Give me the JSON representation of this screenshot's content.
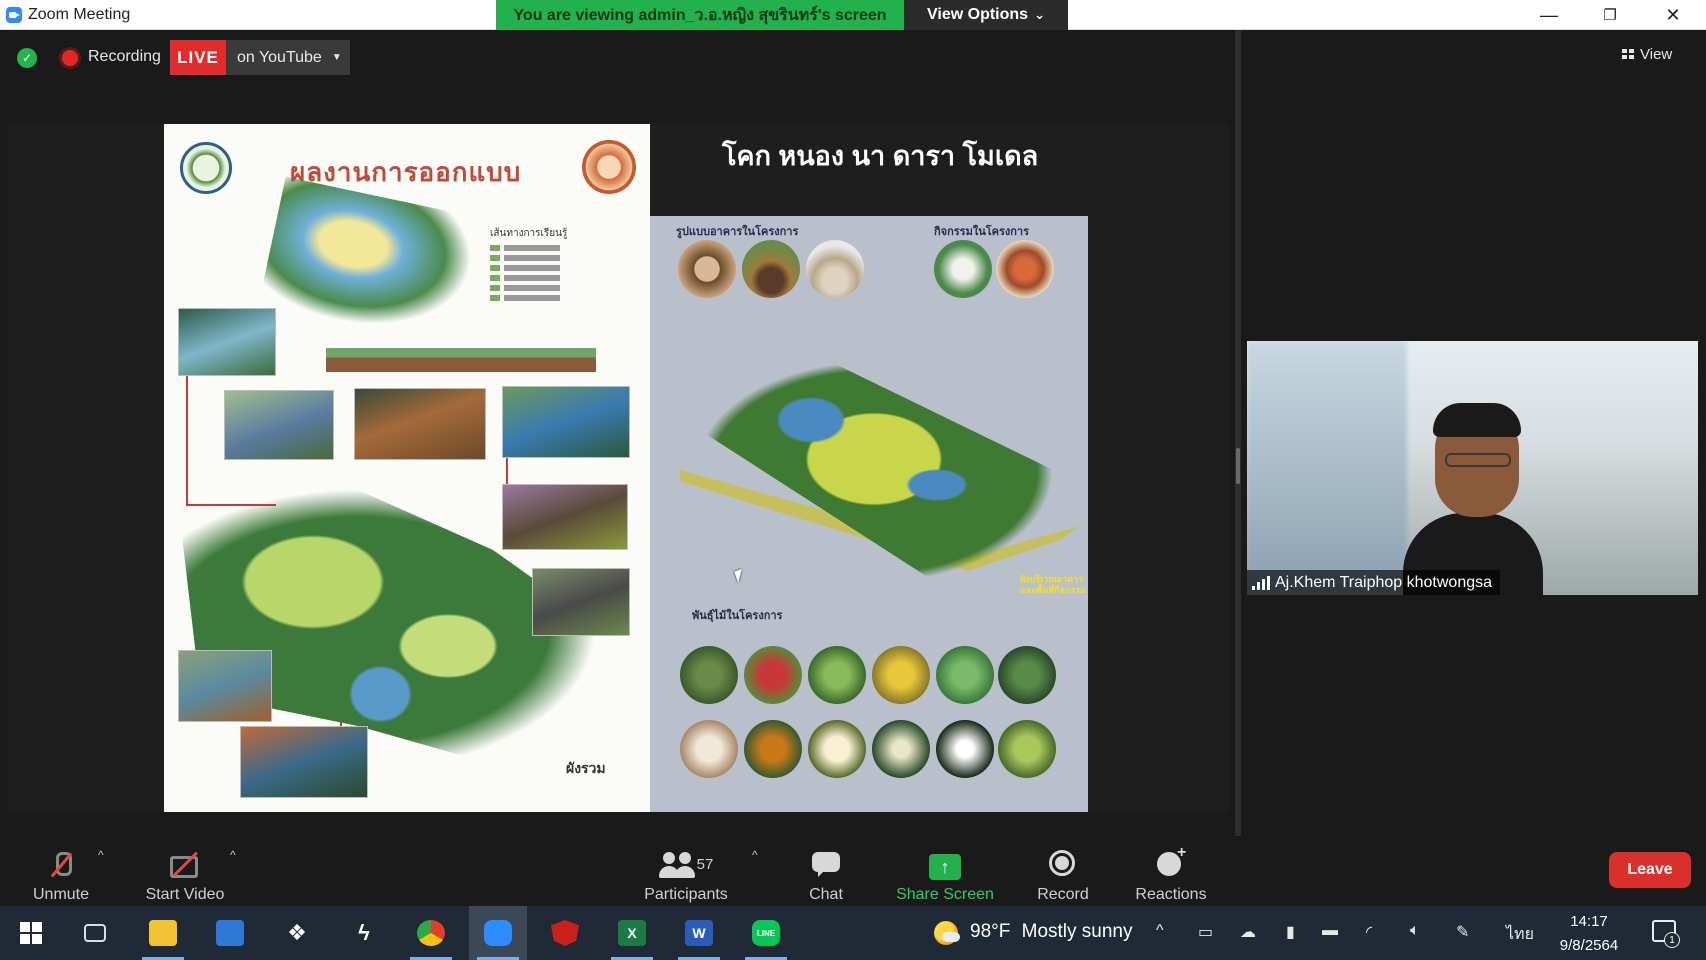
{
  "window": {
    "title": "Zoom Meeting",
    "minimize": "—",
    "restore": "❐",
    "close": "✕"
  },
  "banner": {
    "viewing_text": "You are viewing admin_ว.อ.หญิง สุขรินทร์'s screen",
    "view_options_label": "View Options",
    "view_options_caret": "⌄"
  },
  "meeting_bar": {
    "recording_label": "Recording",
    "live_label": "LIVE",
    "stream_target": "on YouTube",
    "view_label": "View"
  },
  "shared_slide": {
    "left_title": "ผลงานการออกแบบ",
    "right_title": "โคก หนอง นา ดารา โมเดล",
    "plan_label": "ผังรวม",
    "section_buildings": "รูปแบบอาคารในโครงการ",
    "section_activities": "กิจกรรมในโครงการ",
    "section_plants": "พันธุ์ไม้ในโครงการ",
    "legend_title": "เส้นทางการเรียนรู้",
    "yellow_note": "ผังบริเวณอาคารและพื้นที่กิจกรรม"
  },
  "participant": {
    "name": "Aj.Khem Traiphop khotwongsa"
  },
  "toolbar": {
    "unmute_label": "Unmute",
    "start_video_label": "Start Video",
    "participants_label": "Participants",
    "participants_count": "57",
    "chat_label": "Chat",
    "share_screen_label": "Share Screen",
    "share_screen_glyph": "↑",
    "record_label": "Record",
    "reactions_label": "Reactions",
    "leave_label": "Leave",
    "caret": "^"
  },
  "taskbar": {
    "weather_temp": "98°F",
    "weather_desc": "Mostly sunny",
    "language": "ไทย",
    "time": "14:17",
    "date": "9/8/2564",
    "notification_count": "1",
    "excel_glyph": "X",
    "word_glyph": "W",
    "line_glyph": "LINE"
  },
  "colors": {
    "share_green": "#22b14c",
    "live_red": "#e22b2b",
    "leave_red": "#d9302c",
    "taskbar_bg": "#1f2a36"
  }
}
